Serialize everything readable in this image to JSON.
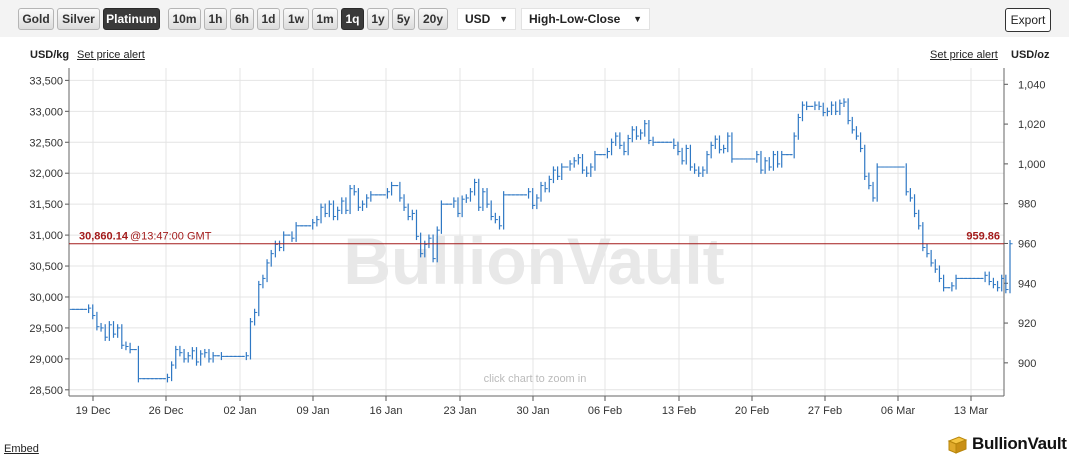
{
  "toolbar": {
    "metals": [
      "Gold",
      "Silver",
      "Platinum"
    ],
    "active_metal": "Platinum",
    "periods": [
      "10m",
      "1h",
      "6h",
      "1d",
      "1w",
      "1m",
      "1q",
      "1y",
      "5y",
      "20y"
    ],
    "active_period": "1q",
    "currency": "USD",
    "chart_style": "High-Low-Close",
    "export_label": "Export"
  },
  "header": {
    "left_unit": "USD/kg",
    "right_unit": "USD/oz",
    "set_alert_label": "Set price alert"
  },
  "watermark": "BullionVault",
  "zoom_hint": "click chart to zoom in",
  "footer": {
    "embed_label": "Embed",
    "logo_text": "BullionVault"
  },
  "colors": {
    "series": "#2f78c4",
    "price_line": "#a31b1b",
    "grid": "#e4e4e4",
    "active_button": "#3a3a3a"
  },
  "chart_data": {
    "type": "ohlc",
    "style": "High-Low-Close",
    "xlabel": "",
    "ylabel_left": "USD/kg",
    "ylabel_right": "USD/oz",
    "x_ticks": [
      "19 Dec",
      "26 Dec",
      "02 Jan",
      "09 Jan",
      "16 Jan",
      "23 Jan",
      "30 Jan",
      "06 Feb",
      "13 Feb",
      "20 Feb",
      "27 Feb",
      "06 Mar",
      "13 Mar"
    ],
    "y_left_ticks": [
      "28,500",
      "29,000",
      "29,500",
      "30,000",
      "30,500",
      "31,000",
      "31,500",
      "32,000",
      "32,500",
      "33,000",
      "33,500"
    ],
    "y_left_range": [
      28400,
      33700
    ],
    "y_right_ticks": [
      "900",
      "920",
      "940",
      "960",
      "980",
      "1,000",
      "1,020",
      "1,040"
    ],
    "current_price_left": 30860.14,
    "current_price_left_label": "30,860.14",
    "current_time_label": "@13:47:00 GMT",
    "current_price_right_label": "959.86",
    "grid": true,
    "series": [
      {
        "name": "Platinum",
        "closes": [
          29800,
          29800,
          29800,
          29800,
          29820,
          29700,
          29520,
          29500,
          29350,
          29550,
          29400,
          29500,
          29220,
          29200,
          29150,
          29150,
          28680,
          28680,
          28680,
          28680,
          28680,
          28680,
          28680,
          28700,
          28900,
          29150,
          29100,
          29000,
          29050,
          29130,
          28950,
          29080,
          29100,
          29000,
          29050,
          29050,
          29040,
          29040,
          29040,
          29040,
          29040,
          29040,
          29050,
          29600,
          29750,
          30200,
          30300,
          30550,
          30700,
          30850,
          30800,
          31000,
          31000,
          30950,
          31150,
          31150,
          31150,
          31150,
          31200,
          31250,
          31450,
          31350,
          31500,
          31300,
          31400,
          31550,
          31400,
          31750,
          31700,
          31450,
          31500,
          31600,
          31650,
          31650,
          31650,
          31650,
          31700,
          31800,
          31800,
          31600,
          31450,
          31300,
          31350,
          30980,
          30700,
          30850,
          30950,
          30620,
          31080,
          31500,
          31500,
          31500,
          31550,
          31350,
          31580,
          31600,
          31700,
          31850,
          31450,
          31700,
          31500,
          31300,
          31250,
          31150,
          31650,
          31650,
          31650,
          31650,
          31650,
          31650,
          31700,
          31480,
          31600,
          31800,
          31750,
          31900,
          32050,
          31950,
          32100,
          32100,
          32150,
          32200,
          32250,
          32050,
          32000,
          32100,
          32300,
          32300,
          32300,
          32350,
          32500,
          32600,
          32450,
          32350,
          32560,
          32700,
          32600,
          32650,
          32800,
          32530,
          32500,
          32500,
          32500,
          32500,
          32500,
          32450,
          32350,
          32200,
          32400,
          32100,
          32050,
          32000,
          32050,
          32300,
          32450,
          32550,
          32380,
          32400,
          32600,
          32230,
          32230,
          32230,
          32230,
          32230,
          32230,
          32300,
          32050,
          32200,
          32100,
          32300,
          32150,
          32300,
          32300,
          32300,
          32600,
          32900,
          33100,
          33080,
          33080,
          33100,
          33080,
          32980,
          33000,
          33100,
          33000,
          33130,
          33150,
          32850,
          32700,
          32600,
          32400,
          31950,
          31800,
          31600,
          32100,
          32100,
          32100,
          32100,
          32100,
          32100,
          32100,
          31700,
          31600,
          31350,
          31150,
          30800,
          30700,
          30550,
          30450,
          30300,
          30150,
          30150,
          30180,
          30300,
          30300,
          30300,
          30300,
          30300,
          30300,
          30300,
          30350,
          30250,
          30200,
          30150,
          30300,
          30120,
          30860
        ]
      }
    ]
  }
}
